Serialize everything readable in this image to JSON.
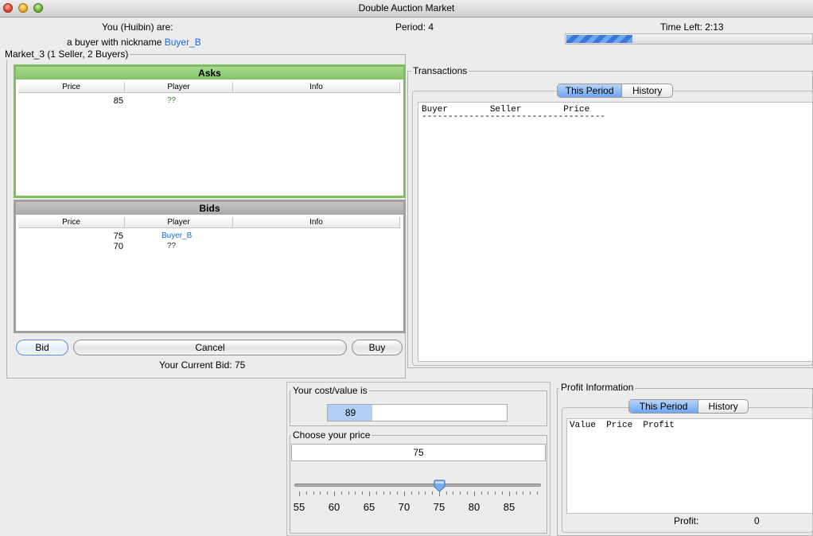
{
  "window": {
    "title": "Double Auction Market"
  },
  "header": {
    "you_label": "You (Huibin) are:",
    "role_prefix": "a buyer with nickname",
    "nickname": "Buyer_B",
    "period": "Period: 4",
    "time_left": "Time Left: 2:13",
    "time_progress_fraction": 0.27
  },
  "market": {
    "title": "Market_3 (1 Seller, 2 Buyers)",
    "asks": {
      "title": "Asks",
      "columns": [
        "Price",
        "Player",
        "Info"
      ],
      "rows": [
        {
          "price": "85",
          "player": "??",
          "info": ""
        }
      ]
    },
    "bids": {
      "title": "Bids",
      "columns": [
        "Price",
        "Player",
        "Info"
      ],
      "rows": [
        {
          "price": "75",
          "player": "Buyer_B",
          "info": ""
        },
        {
          "price": "70",
          "player": "??",
          "info": ""
        }
      ]
    },
    "buttons": {
      "bid": "Bid",
      "cancel": "Cancel",
      "buy": "Buy"
    },
    "current_bid": "Your Current Bid:  75"
  },
  "transactions": {
    "title": "Transactions",
    "tabs": [
      "This Period",
      "History"
    ],
    "selected_tab": "This Period",
    "header_line": "Buyer        Seller        Price",
    "divider": "-----------------------------------"
  },
  "cost": {
    "title": "Your cost/value is",
    "value": "89",
    "value_fraction": 0.25
  },
  "price": {
    "title": "Choose your price",
    "value": "75",
    "slider_labels": [
      "55",
      "60",
      "65",
      "70",
      "75",
      "80",
      "85"
    ],
    "slider_min": 55,
    "slider_max": 89,
    "slider_value": 75
  },
  "profit": {
    "title": "Profit Information",
    "tabs": [
      "This Period",
      "History"
    ],
    "selected_tab": "This Period",
    "header_line": "Value  Price  Profit",
    "profit_label": "Profit:",
    "profit_value": "0"
  }
}
